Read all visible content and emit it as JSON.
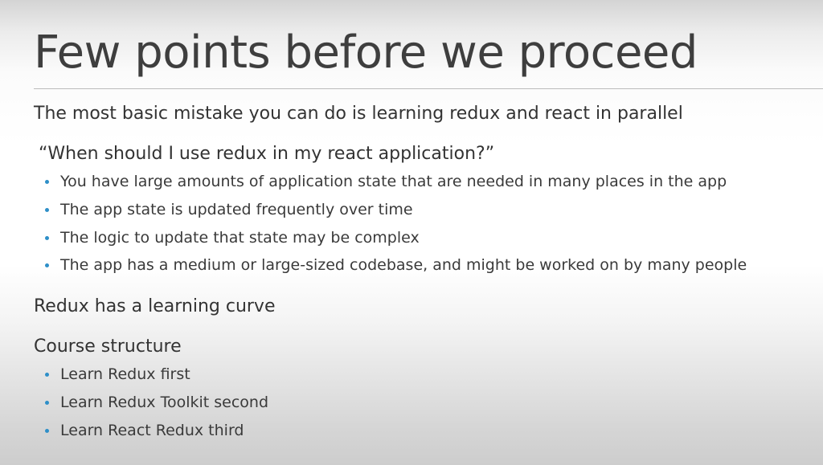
{
  "slide": {
    "title": "Few points before we proceed",
    "statement": "The most basic mistake you can do is learning redux and react in parallel",
    "question": "“When should I use redux in my react application?”",
    "question_bullets": [
      "You have large amounts of application state that are needed in many places in the app",
      "The app state is updated frequently over time",
      "The logic to update that state may be complex",
      "The app has a medium or large-sized codebase, and might be worked on by many people"
    ],
    "learning_curve": "Redux has a learning curve",
    "course_heading": "Course structure",
    "course_bullets": [
      "Learn Redux first",
      "Learn Redux Toolkit second",
      "Learn React Redux third"
    ],
    "bullet_color": "#2e8fc8",
    "title_color": "#3e3e3e"
  }
}
